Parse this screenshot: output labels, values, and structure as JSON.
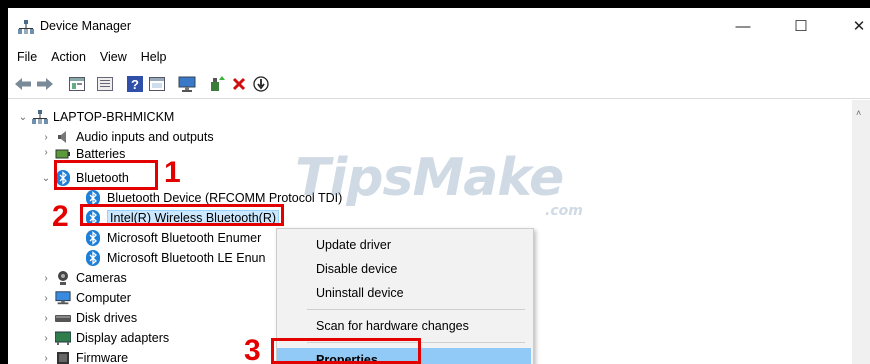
{
  "window": {
    "title": "Device Manager",
    "controls": {
      "minimize": "—",
      "maximize": "☐",
      "close": "✕"
    }
  },
  "menubar": {
    "items": [
      "File",
      "Action",
      "View",
      "Help"
    ]
  },
  "toolbar": {
    "icons": [
      "back-icon",
      "forward-icon",
      "properties-icon",
      "view-icon",
      "help-icon",
      "action-icon",
      "monitor-icon",
      "update-driver-icon",
      "uninstall-icon",
      "scan-icon"
    ]
  },
  "tree": {
    "root": "LAPTOP-BRHMICKM",
    "items": [
      {
        "label": "Audio inputs and outputs",
        "icon": "speaker-icon",
        "expanded": false
      },
      {
        "label": "Batteries",
        "icon": "battery-icon",
        "expanded": false
      },
      {
        "label": "Bluetooth",
        "icon": "bluetooth-icon",
        "expanded": true
      },
      {
        "label": "Bluetooth Device (RFCOMM Protocol TDI)",
        "icon": "bluetooth-icon",
        "child": true
      },
      {
        "label": "Intel(R) Wireless Bluetooth(R)",
        "icon": "bluetooth-icon",
        "child": true,
        "selected": true
      },
      {
        "label": "Microsoft Bluetooth Enumer",
        "icon": "bluetooth-icon",
        "child": true
      },
      {
        "label": "Microsoft Bluetooth LE Enun",
        "icon": "bluetooth-icon",
        "child": true
      },
      {
        "label": "Cameras",
        "icon": "camera-icon",
        "expanded": false
      },
      {
        "label": "Computer",
        "icon": "computer-icon",
        "expanded": false
      },
      {
        "label": "Disk drives",
        "icon": "disk-icon",
        "expanded": false
      },
      {
        "label": "Display adapters",
        "icon": "display-icon",
        "expanded": false
      },
      {
        "label": "Firmware",
        "icon": "firmware-icon",
        "expanded": false
      }
    ]
  },
  "context_menu": {
    "items": [
      "Update driver",
      "Disable device",
      "Uninstall device",
      "Scan for hardware changes",
      "Properties"
    ],
    "highlighted": "Properties"
  },
  "annotations": {
    "step1": "1",
    "step2": "2",
    "step3": "3",
    "color": "#e30000"
  },
  "watermark": {
    "brand": "TipsMake",
    "domain": ".com"
  }
}
